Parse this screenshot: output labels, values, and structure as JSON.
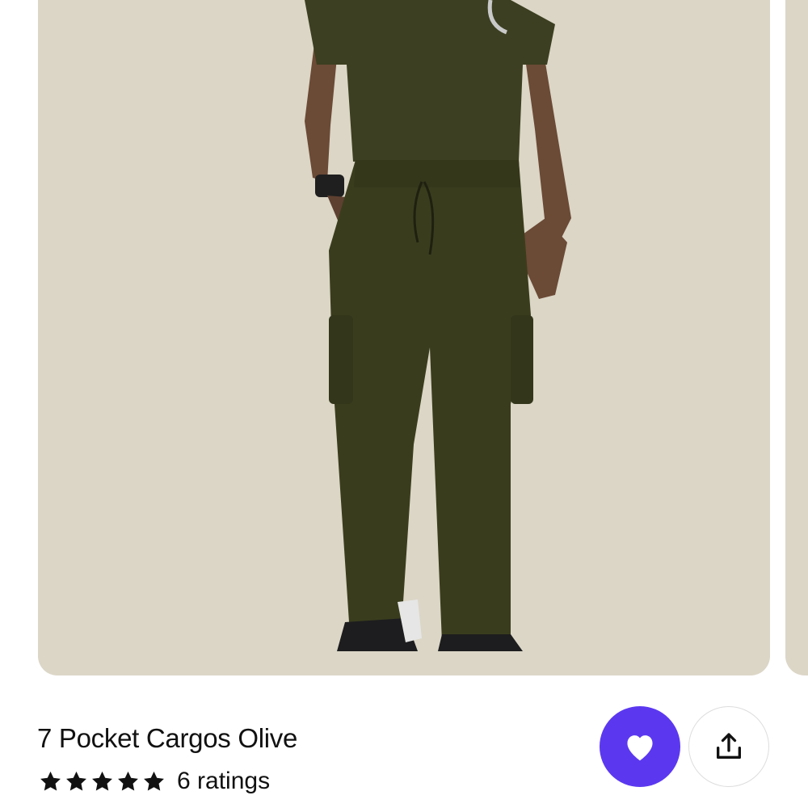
{
  "product": {
    "title": "7 Pocket Cargos Olive",
    "rating_stars": 5,
    "ratings_label": "6 ratings",
    "image_alt": "Model wearing olive scrub top and 7 pocket cargo pants",
    "image_background": "#dbd6c6",
    "garment_color": "#3b3f1e"
  },
  "actions": {
    "favorite_color": "#5b38f0",
    "favorite_icon": "heart-icon",
    "share_icon": "share-icon"
  }
}
